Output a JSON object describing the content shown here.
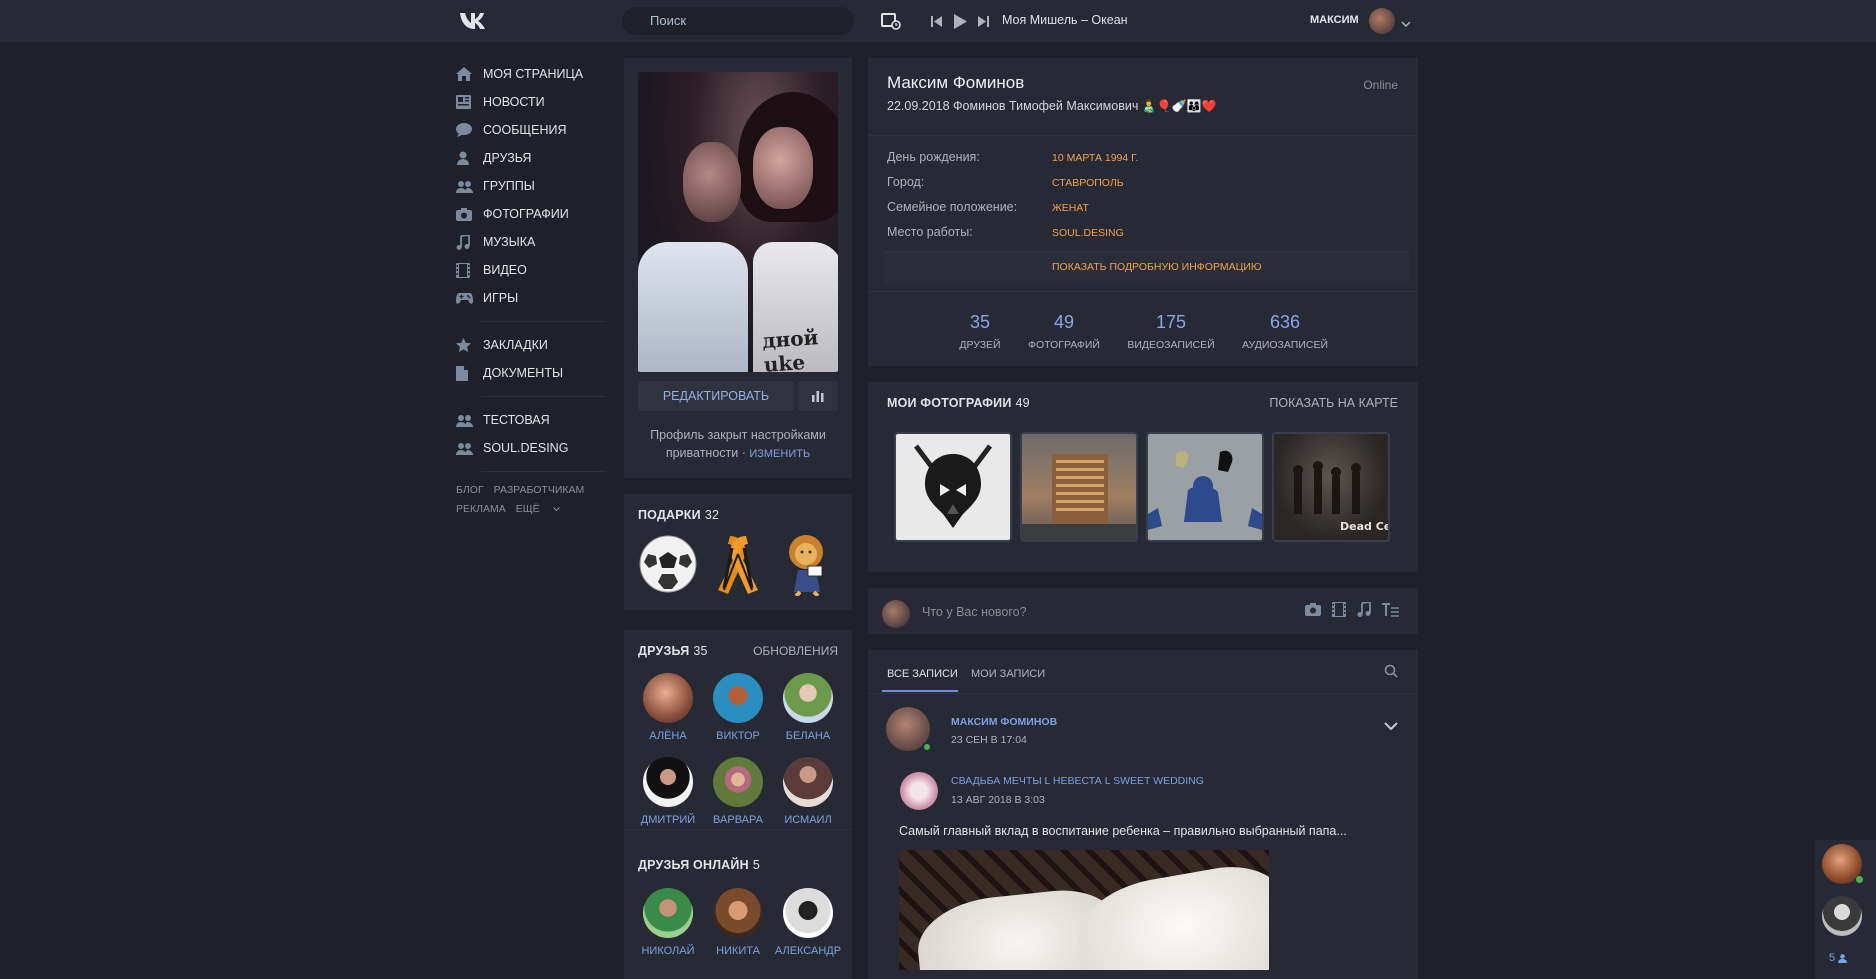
{
  "header": {
    "search_placeholder": "Поиск",
    "track": "Моя Мишель – Океан",
    "user_name": "МАКСИМ"
  },
  "menu": {
    "items": [
      {
        "label": "МОЯ СТРАНИЦА",
        "icon": "home-icon"
      },
      {
        "label": "НОВОСТИ",
        "icon": "news-icon"
      },
      {
        "label": "СООБЩЕНИЯ",
        "icon": "messages-icon"
      },
      {
        "label": "ДРУЗЬЯ",
        "icon": "friends-icon"
      },
      {
        "label": "ГРУППЫ",
        "icon": "groups-icon"
      },
      {
        "label": "ФОТОГРАФИИ",
        "icon": "camera-icon"
      },
      {
        "label": "МУЗЫКА",
        "icon": "music-icon"
      },
      {
        "label": "ВИДЕО",
        "icon": "video-icon"
      },
      {
        "label": "ИГРЫ",
        "icon": "gamepad-icon"
      }
    ],
    "items2": [
      {
        "label": "ЗАКЛАДКИ",
        "icon": "star-icon"
      },
      {
        "label": "ДОКУМЕНТЫ",
        "icon": "document-icon"
      }
    ],
    "items3": [
      {
        "label": "ТЕСТОВАЯ",
        "icon": "groups-icon"
      },
      {
        "label": "SOUL.DESING",
        "icon": "groups-icon"
      }
    ],
    "footer": {
      "blog": "БЛОГ",
      "dev": "РАЗРАБОТЧИКАМ",
      "ads": "РЕКЛАМА",
      "more": "ЕЩЁ"
    }
  },
  "left": {
    "edit_label": "РЕДАКТИРОВАТЬ",
    "privacy_text_1": "Профиль закрыт настройками",
    "privacy_text_2": "приватности",
    "privacy_link": "ИЗМЕНИТЬ",
    "gifts_title": "ПОДАРКИ",
    "gifts_count": "32",
    "gift_print": "шной\nluke",
    "friends_title": "ДРУЗЬЯ",
    "friends_count": "35",
    "friends_updates": "ОБНОВЛЕНИЯ",
    "friends": [
      "АЛЁНА",
      "ВИКТОР",
      "БЕЛАНА",
      "ДМИТРИЙ",
      "ВАРВАРА",
      "ИСМАИЛ"
    ],
    "online_title": "ДРУЗЬЯ ОНЛАЙН",
    "online_count": "5",
    "online_friends": [
      "НИКОЛАЙ",
      "НИКИТА",
      "АЛЕКСАНДР"
    ]
  },
  "profile": {
    "name": "Максим Фоминов",
    "status": "22.09.2018 Фоминов Тимофей Максимович",
    "online": "Online",
    "info": [
      {
        "label": "День рождения:",
        "value": "10 МАРТА 1994 Г."
      },
      {
        "label": "Город:",
        "value": "СТАВРОПОЛЬ"
      },
      {
        "label": "Семейное положение:",
        "value": "ЖЕНАТ"
      },
      {
        "label": "Место работы:",
        "value": "SOUL.DESING"
      }
    ],
    "more_info": "ПОКАЗАТЬ ПОДРОБНУЮ ИНФОРМАЦИЮ",
    "counters": [
      {
        "num": "35",
        "label": "ДРУЗЕЙ"
      },
      {
        "num": "49",
        "label": "ФОТОГРАФИЙ"
      },
      {
        "num": "175",
        "label": "ВИДЕОЗАПИСЕЙ"
      },
      {
        "num": "636",
        "label": "АУДИОЗАПИСЕЙ"
      }
    ]
  },
  "photos": {
    "title": "МОИ ФОТОГРАФИИ",
    "count": "49",
    "map_link": "ПОКАЗАТЬ НА КАРТЕ",
    "dead_center": "Dead Center"
  },
  "composer": {
    "placeholder": "Что у Вас нового?"
  },
  "wall": {
    "tab_all": "ВСЕ ЗАПИСИ",
    "tab_mine": "МОИ ЗАПИСИ",
    "post": {
      "author": "МАКСИМ ФОМИНОВ",
      "date": "23 СЕН В 17:04",
      "repost_author": "СВАДЬБА МЕЧТЫ L НЕВЕСТА L SWEET WEDDING",
      "repost_date": "13 АВГ 2018 В 3:03",
      "text": "Самый главный вклад в воспитание ребенка – правильно выбранный папа..."
    }
  },
  "chat": {
    "online_count": "5"
  },
  "colors": {
    "accent": "#79a2e0",
    "orange": "#f0a24c",
    "bg": "#1f2029",
    "panel": "#272934"
  }
}
